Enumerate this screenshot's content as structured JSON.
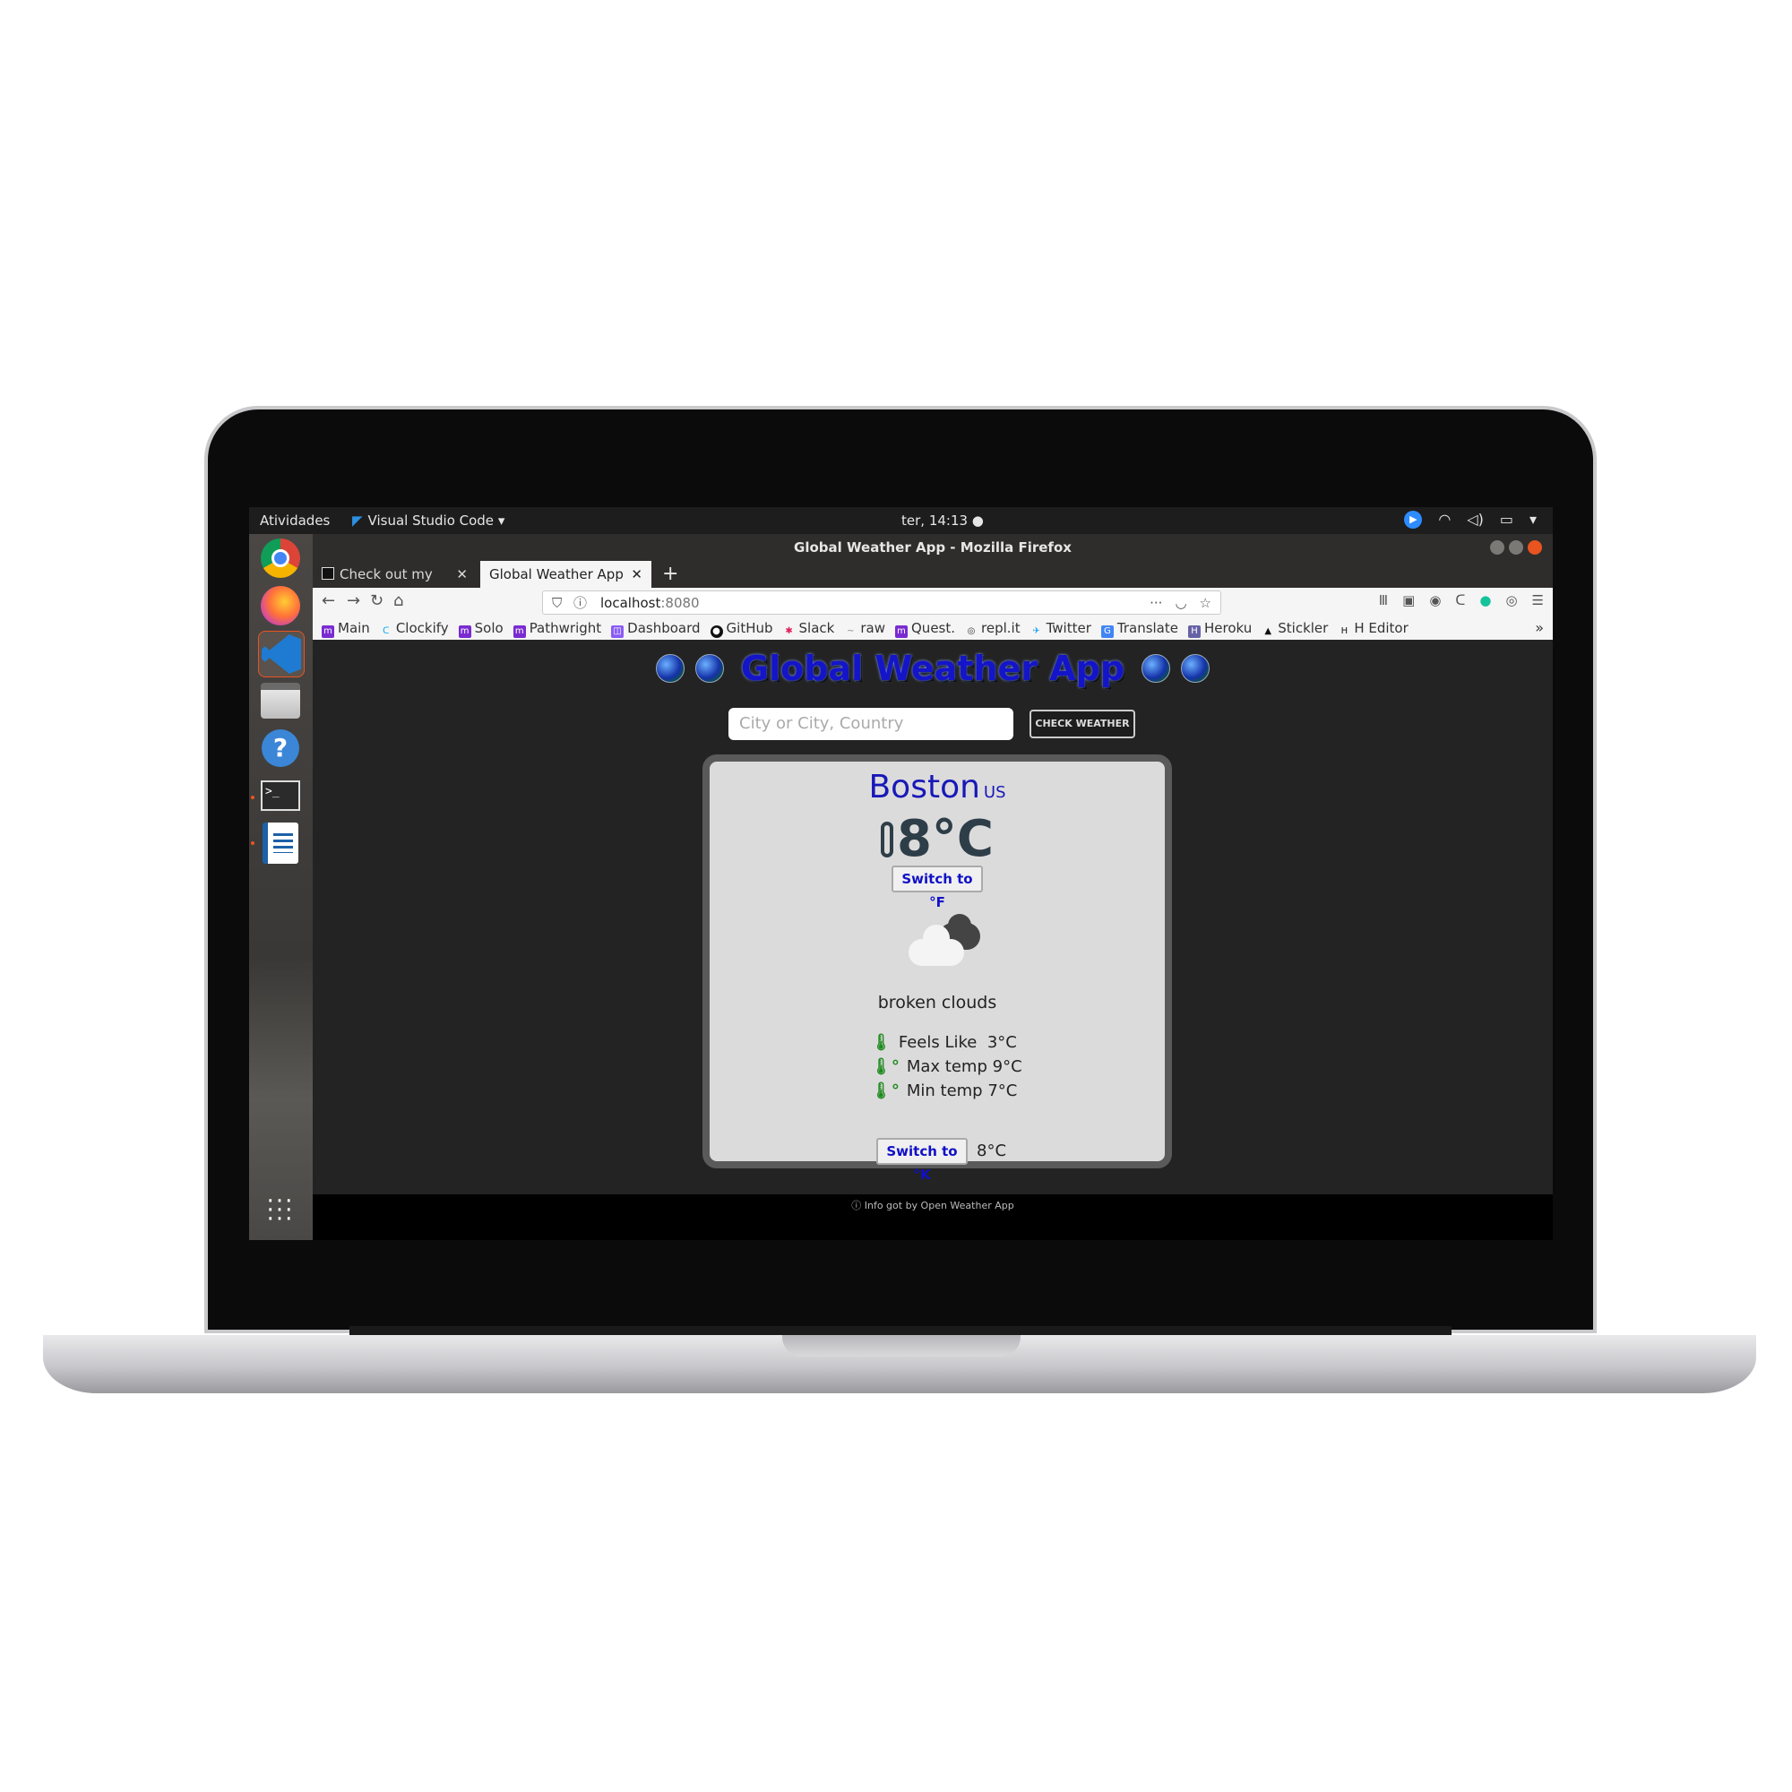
{
  "topbar": {
    "activities": "Atividades",
    "app_name": "Visual Studio Code",
    "clock": "ter, 14:13 ●",
    "tray_icons": [
      "zoom-icon",
      "wifi-icon",
      "volume-icon",
      "battery-icon",
      "menu-arrow-icon"
    ]
  },
  "dock": {
    "apps": [
      "chrome",
      "firefox",
      "vscode",
      "files",
      "help",
      "terminal",
      "libreoffice-writer",
      "show-apps"
    ]
  },
  "window": {
    "title": "Global Weather App - Mozilla Firefox"
  },
  "tabs": [
    {
      "label": "Check out my mockup o"
    },
    {
      "label": "Global Weather App"
    }
  ],
  "url": {
    "host": "localhost",
    "port": ":8080"
  },
  "bookmarks": [
    {
      "label": "Main"
    },
    {
      "label": "Clockify"
    },
    {
      "label": "Solo"
    },
    {
      "label": "Pathwright"
    },
    {
      "label": "Dashboard"
    },
    {
      "label": "GitHub"
    },
    {
      "label": "Slack"
    },
    {
      "label": "raw"
    },
    {
      "label": "Quest."
    },
    {
      "label": "repl.it"
    },
    {
      "label": "Twitter"
    },
    {
      "label": "Translate"
    },
    {
      "label": "Heroku"
    },
    {
      "label": "Stickler"
    },
    {
      "label": "H Editor"
    }
  ],
  "app": {
    "title": "Global Weather App",
    "search_placeholder": "City or City, Country",
    "check_button": "CHECK WEATHER"
  },
  "weather": {
    "city": "Boston",
    "country": "US",
    "temp": "8°C",
    "switch_f": "Switch to °F",
    "description": "broken clouds",
    "feels_like_label": "Feels Like",
    "feels_like_value": "3°C",
    "max_label": "Max temp",
    "max_value": "9°C",
    "min_label": "Min temp",
    "min_value": "7°C",
    "switch_k": "Switch to °K",
    "switch_k_value": "8°C"
  },
  "footer": {
    "text": "Info got by Open Weather App"
  },
  "colors": {
    "title_blue": "#1414c8",
    "card_bg": "#dcdbdc",
    "page_bg": "#232323"
  }
}
